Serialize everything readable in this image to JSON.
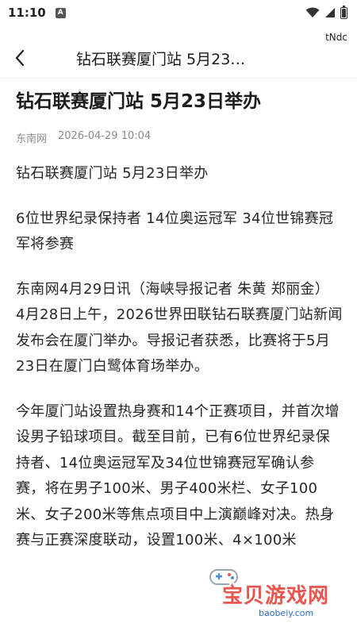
{
  "status_bar": {
    "time": "11:10",
    "notification_letter": "A",
    "battery_level": 0.8
  },
  "header": {
    "extra_label": "tNdc",
    "title": "钻石联赛厦门站 5月23…",
    "back_icon": "chevron-left-icon"
  },
  "article": {
    "title": "钻石联赛厦门站 5月23日举办",
    "source": "东南网",
    "datetime": "2026-04-29 10:04",
    "paragraphs": [
      "钻石联赛厦门站 5月23日举办",
      "6位世界纪录保持者 14位奥运冠军 34位世锦赛冠军将参赛",
      "东南网4月29日讯（海峡导报记者 朱黄 郑丽金） 4月28日上午，2026世界田联钻石联赛厦门站新闻发布会在厦门举办。导报记者获悉，比赛将于5月23日在厦门白鹭体育场举办。",
      "今年厦门站设置热身赛和14个正赛项目，并首次增设男子铅球项目。截至目前，已有6位世界纪录保持者、14位奥运冠军及34位世锦赛冠军确认参赛，将在男子100米、男子400米栏、女子100米、女子200米等焦点项目中上演巅峰对决。热身赛与正赛深度联动，设置100米、4×100米"
    ]
  },
  "watermark": {
    "text": "宝贝游戏网",
    "url": "baobeiy.com"
  },
  "colors": {
    "watermark_red": "#e8564f",
    "watermark_blue": "#2b6cc4",
    "meta_gray": "#8a8a8a"
  }
}
